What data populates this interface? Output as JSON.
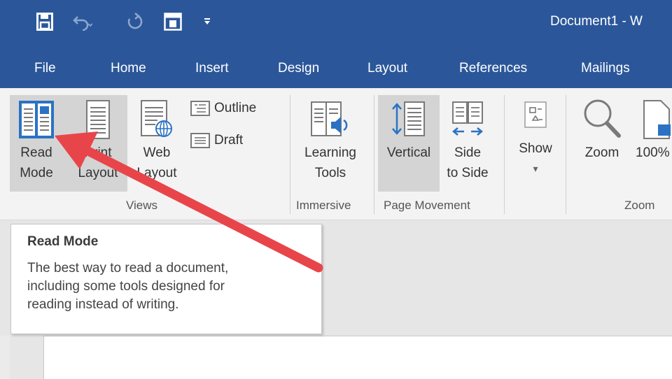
{
  "titlebar": {
    "document_title": "Document1  -  W",
    "icons": [
      "save-icon",
      "undo-icon",
      "redo-icon",
      "touch-mode-icon",
      "customize-qat-icon"
    ],
    "color": "#2b579a"
  },
  "tabs": [
    "File",
    "Home",
    "Insert",
    "Design",
    "Layout",
    "References",
    "Mailings"
  ],
  "ribbon": {
    "views": {
      "read_mode": [
        "Read",
        "Mode"
      ],
      "print_layout": [
        "Print",
        "Layout"
      ],
      "web_layout": [
        "Web",
        "Layout"
      ],
      "outline": "Outline",
      "draft": "Draft",
      "group_label": "Views"
    },
    "immersive": {
      "learning_tools": [
        "Learning",
        "Tools"
      ],
      "group_label": "Immersive"
    },
    "page_movement": {
      "vertical": "Vertical",
      "side_to_side": [
        "Side",
        "to Side"
      ],
      "group_label": "Page Movement"
    },
    "show": {
      "label": "Show",
      "dropdown": "▾"
    },
    "zoom": {
      "zoom": "Zoom",
      "hundred": "100%",
      "group_label": "Zoom"
    }
  },
  "tooltip": {
    "title": "Read Mode",
    "lines": [
      "The best way to read a document,",
      "including some tools designed for",
      "reading instead of writing."
    ]
  },
  "annotation": {
    "arrow_color": "#e8454a"
  }
}
